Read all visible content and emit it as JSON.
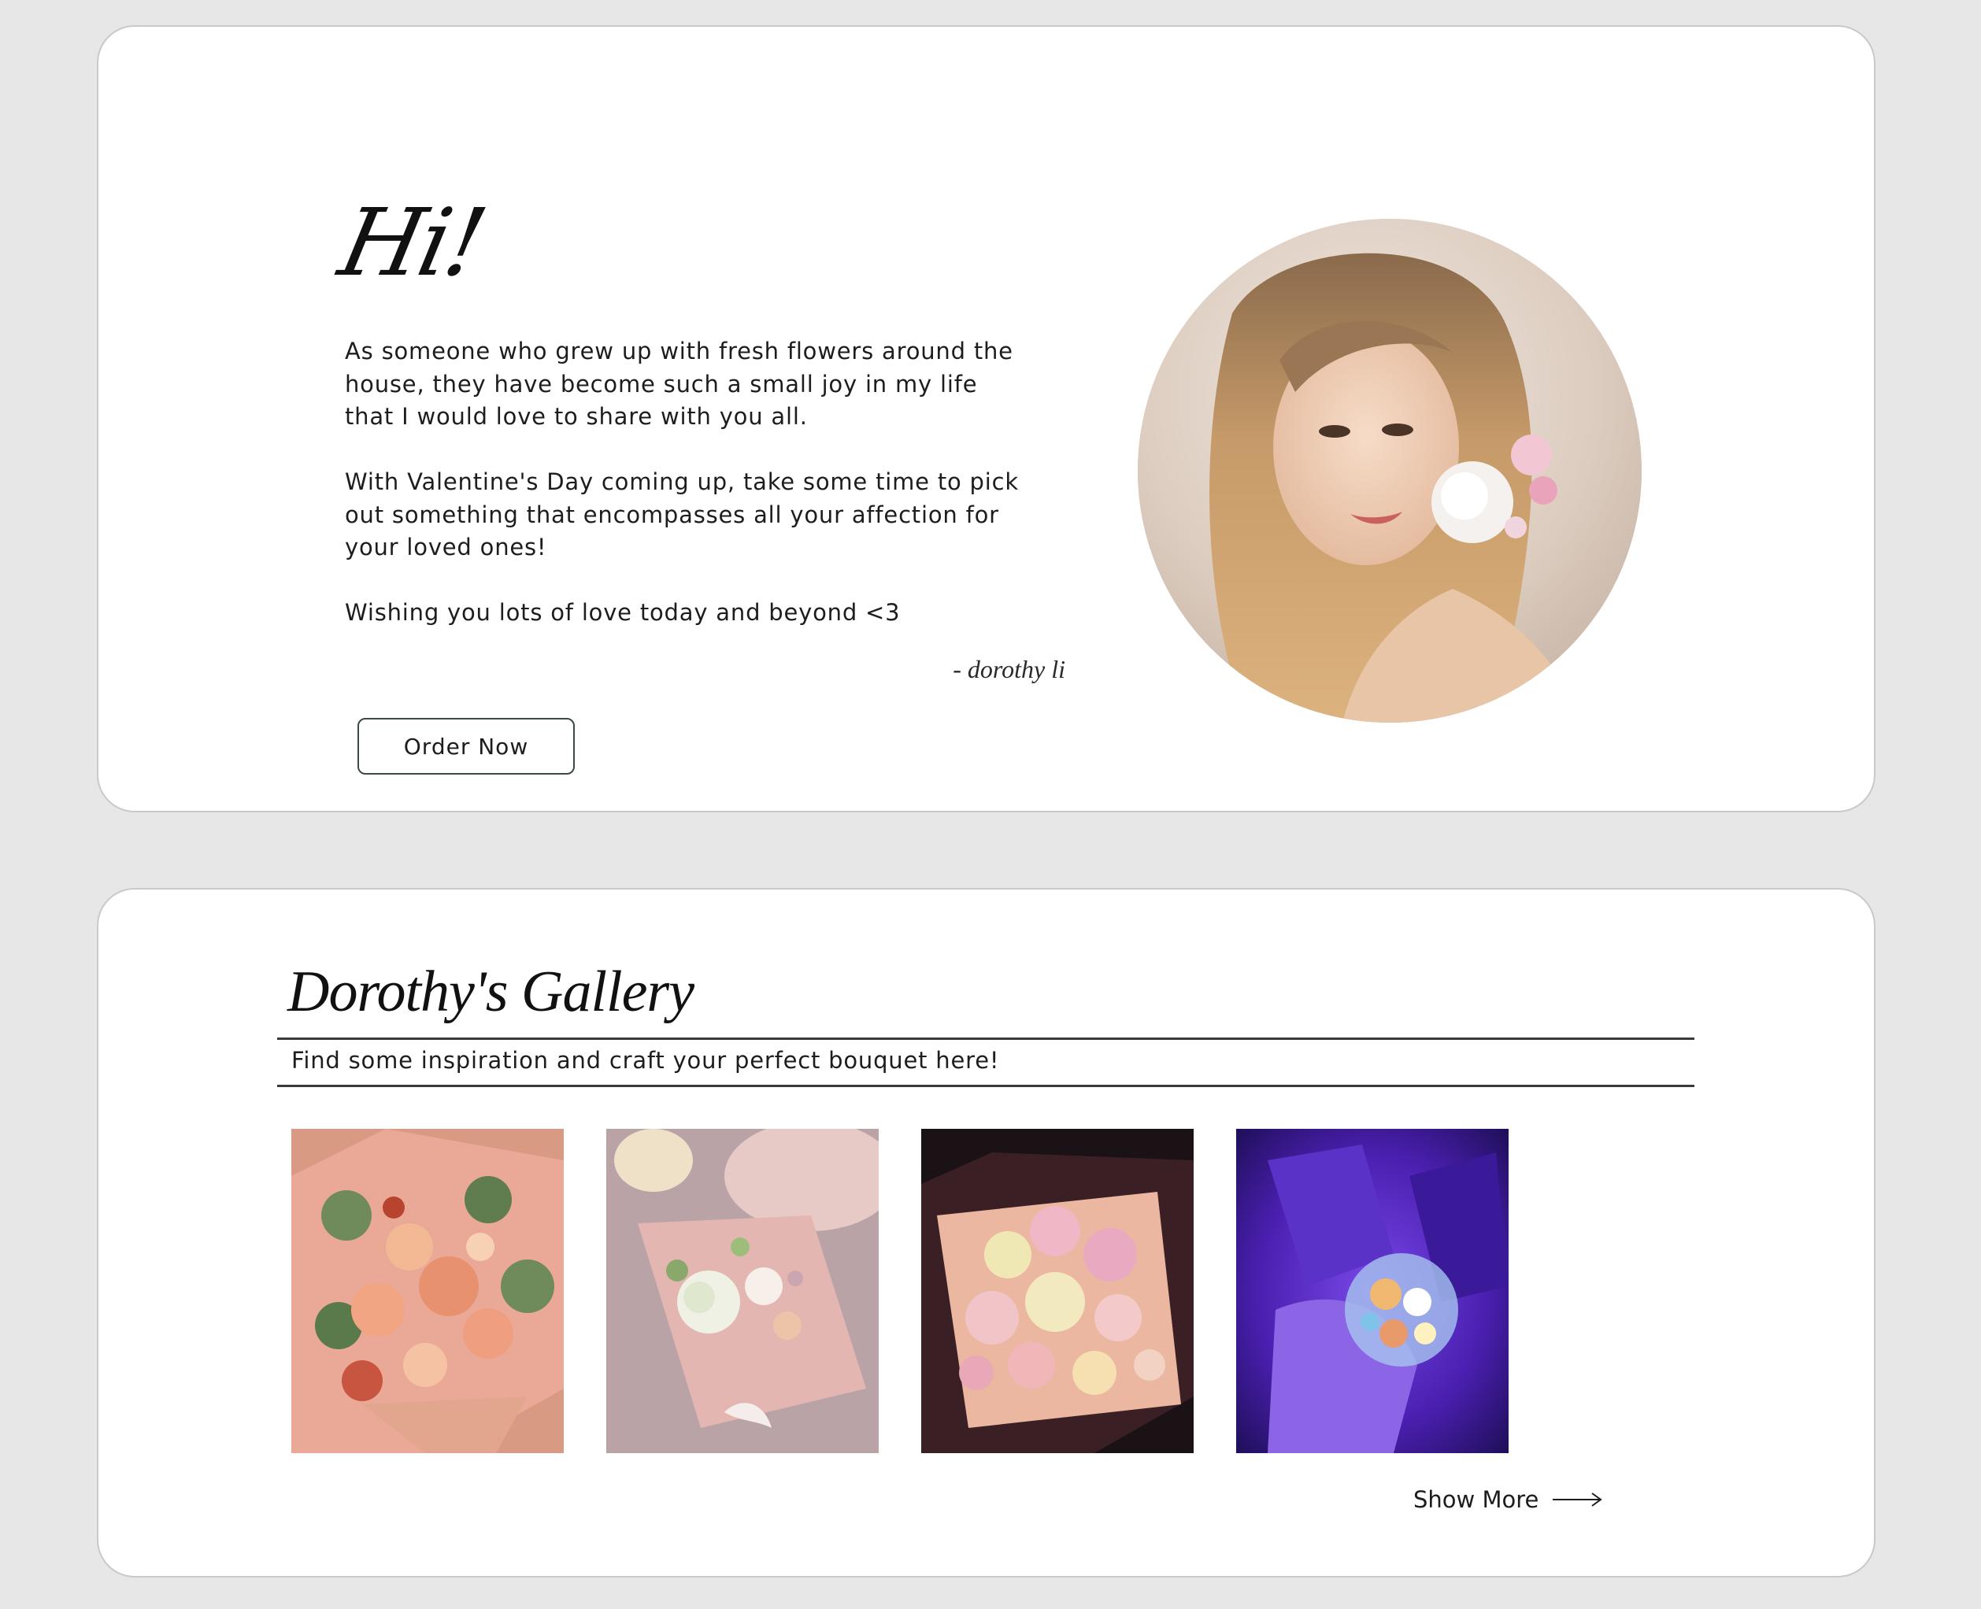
{
  "about": {
    "greeting": "Hi!",
    "paragraphs": [
      "As someone who grew up with fresh flowers around the house, they have become such a small joy in my life that I would love to share with you all.",
      "With Valentine's Day coming up, take some time to pick out something that encompasses all your affection for your loved ones!",
      "Wishing you lots of love today and beyond <3"
    ],
    "signature": "- dorothy li",
    "order_button": "Order Now"
  },
  "gallery": {
    "title": "Dorothy's Gallery",
    "subtitle": "Find some inspiration and craft your perfect bouquet here!",
    "show_more": "Show More"
  },
  "colors": {
    "page_background": "#e8e7e7",
    "card_background": "#ffffff",
    "button_border": "#3b4a49"
  }
}
